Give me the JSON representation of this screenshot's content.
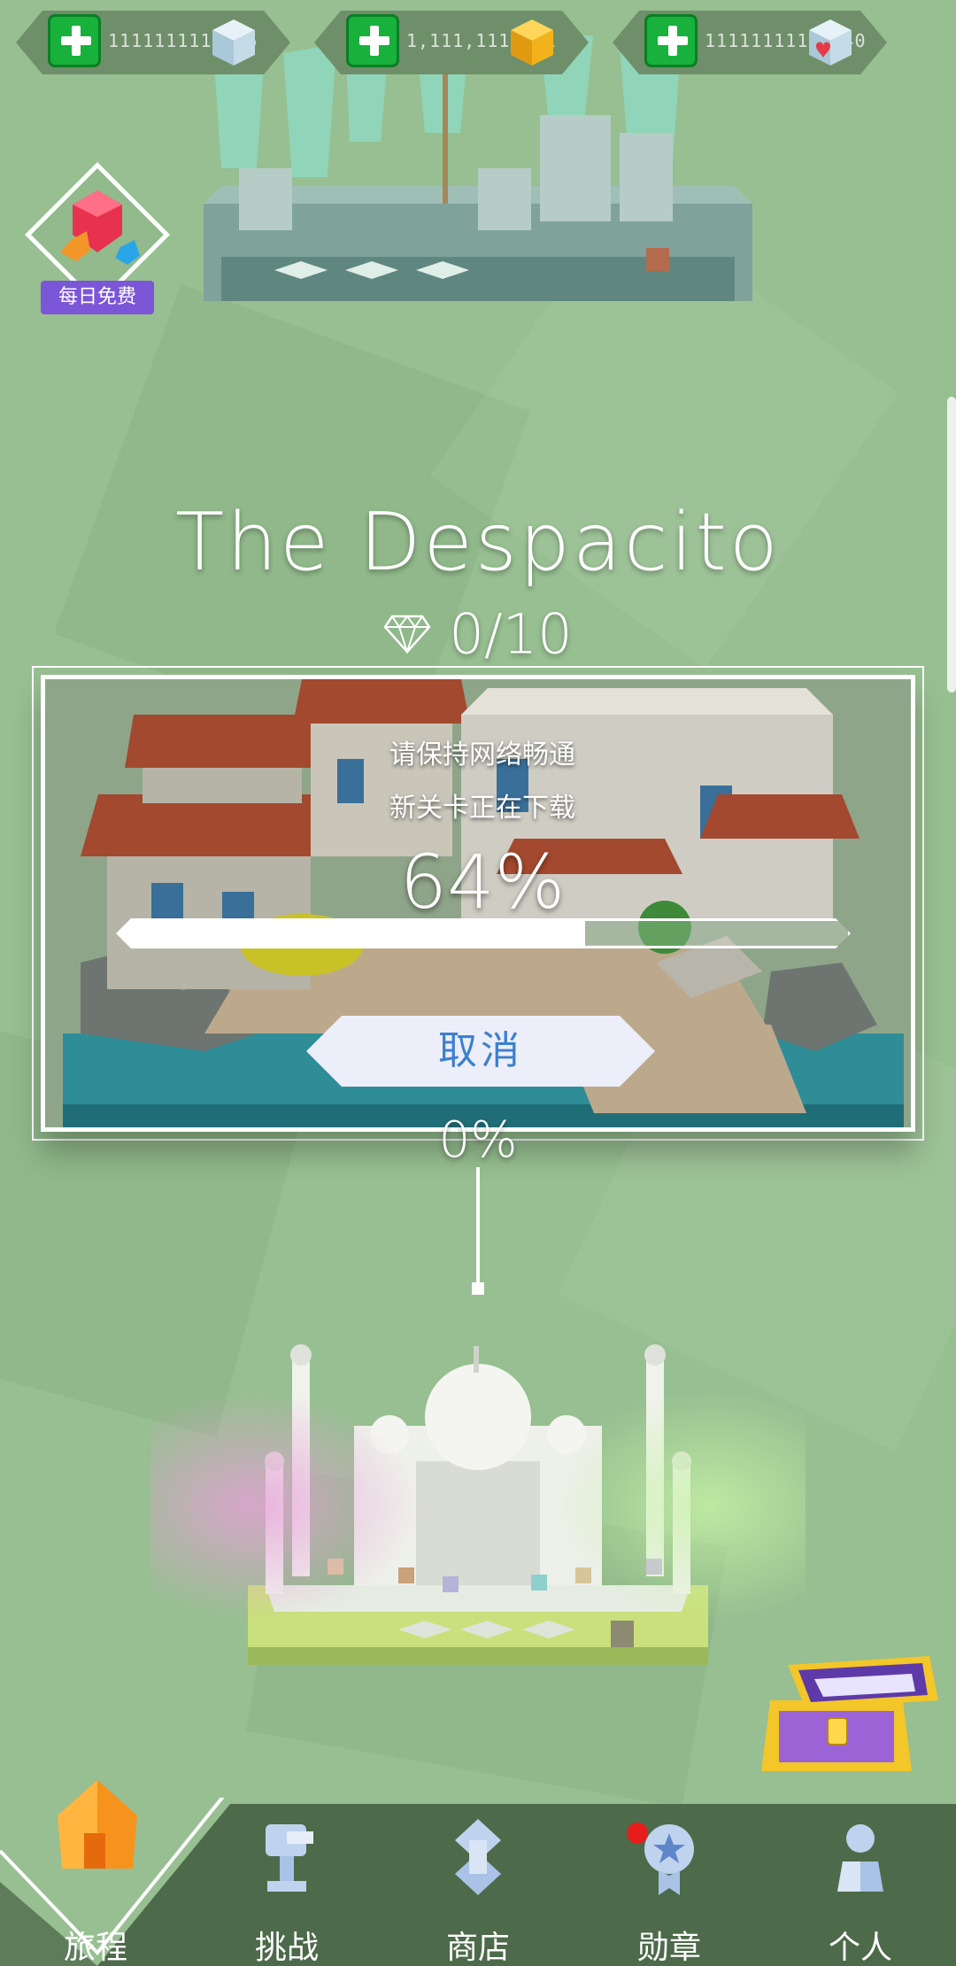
{
  "resources": [
    {
      "value": "1111111111/15",
      "cube": "ice-cube-icon",
      "color": "#bcd8e6"
    },
    {
      "value": "1,111,111,111",
      "cube": "gold-cube-icon",
      "color": "#f2b21c"
    },
    {
      "value": "11111111111/40",
      "cube": "heart-cube-icon",
      "color": "#bcd8e6"
    }
  ],
  "daily_gift": {
    "label": "每日免费"
  },
  "level": {
    "title": "The Despacito",
    "gems": "0/10"
  },
  "download": {
    "message1": "请保持网络畅通",
    "message2": "新关卡正在下载",
    "percent_label": "64%",
    "progress": 0.64,
    "cancel_label": "取消"
  },
  "next_progress_label": "0%",
  "nav": {
    "items": [
      {
        "label": "旅程",
        "icon": "home-icon",
        "active": true
      },
      {
        "label": "挑战",
        "icon": "trophy-icon"
      },
      {
        "label": "商店",
        "icon": "shop-icon"
      },
      {
        "label": "勋章",
        "icon": "medal-icon",
        "notification": true
      },
      {
        "label": "个人",
        "icon": "profile-icon"
      }
    ]
  },
  "colors": {
    "background": "#97bf91",
    "plus_green": "#17b13b",
    "cancel_text": "#3b7fd0",
    "daily_purple": "#7b56d6",
    "notification": "#e81c1c"
  }
}
